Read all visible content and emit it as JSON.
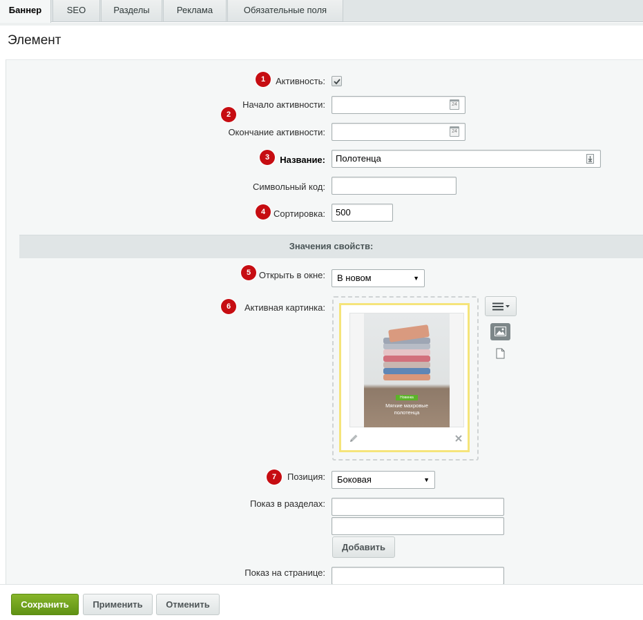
{
  "tabs": [
    {
      "label": "Баннер",
      "active": true
    },
    {
      "label": "SEO"
    },
    {
      "label": "Разделы"
    },
    {
      "label": "Реклама"
    },
    {
      "label": "Обязательные поля"
    }
  ],
  "page_title": "Элемент",
  "markers": [
    "1",
    "2",
    "3",
    "4",
    "5",
    "6",
    "7"
  ],
  "fields": {
    "active": {
      "label": "Активность:",
      "checked": true
    },
    "active_from": {
      "label": "Начало активности:",
      "value": "",
      "cal_icon_text": "24"
    },
    "active_to": {
      "label": "Окончание активности:",
      "value": "",
      "cal_icon_text": "24"
    },
    "name": {
      "label": "Название:",
      "value": "Полотенца"
    },
    "code": {
      "label": "Символьный код:",
      "value": ""
    },
    "sort": {
      "label": "Сортировка:",
      "value": "500"
    }
  },
  "section_title": "Значения свойств:",
  "properties": {
    "open_in_window": {
      "label": "Открыть в окне:",
      "selected": "В новом"
    },
    "active_image": {
      "label": "Активная картинка:",
      "photo_badge": "Новинка",
      "photo_caption_line1": "Мягкие махровые",
      "photo_caption_line2": "полотенца"
    },
    "position": {
      "label": "Позиция:",
      "selected": "Боковая"
    },
    "show_in_sections": {
      "label": "Показ в разделах:",
      "add_button": "Добавить"
    },
    "show_on_page": {
      "label": "Показ на странице:"
    }
  },
  "footer": {
    "save": "Сохранить",
    "apply": "Применить",
    "cancel": "Отменить"
  },
  "colors": {
    "marker": "#c60d12",
    "save_button": "#6e9f13",
    "image_frame": "#f5e47a",
    "section_band": "#e0e5e6"
  }
}
